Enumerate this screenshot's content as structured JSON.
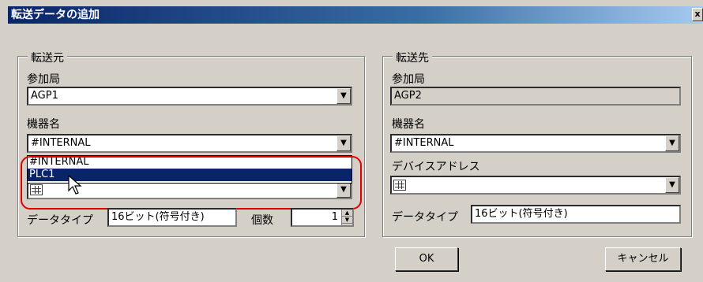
{
  "dialog": {
    "title": "転送データの追加",
    "close_label": "x"
  },
  "source": {
    "group_label": "転送元",
    "station_label": "参加局",
    "station_value": "AGP1",
    "device_label": "機器名",
    "device_value": "#INTERNAL",
    "device_options": [
      "#INTERNAL",
      "PLC1"
    ],
    "device_selected_option": "PLC1",
    "datatype_label": "データタイプ",
    "datatype_value": "16ビット(符号付き)",
    "count_label": "個数",
    "count_value": "1"
  },
  "dest": {
    "group_label": "転送先",
    "station_label": "参加局",
    "station_value": "AGP2",
    "device_label": "機器名",
    "device_value": "#INTERNAL",
    "address_label": "デバイスアドレス",
    "address_value": "",
    "datatype_label": "データタイプ",
    "datatype_value": "16ビット(符号付き)"
  },
  "buttons": {
    "ok_label": "OK",
    "cancel_label": "キャンセル"
  },
  "colors": {
    "title_bar": "#0a246a",
    "highlight": "#e00000",
    "selection": "#0a246a"
  }
}
